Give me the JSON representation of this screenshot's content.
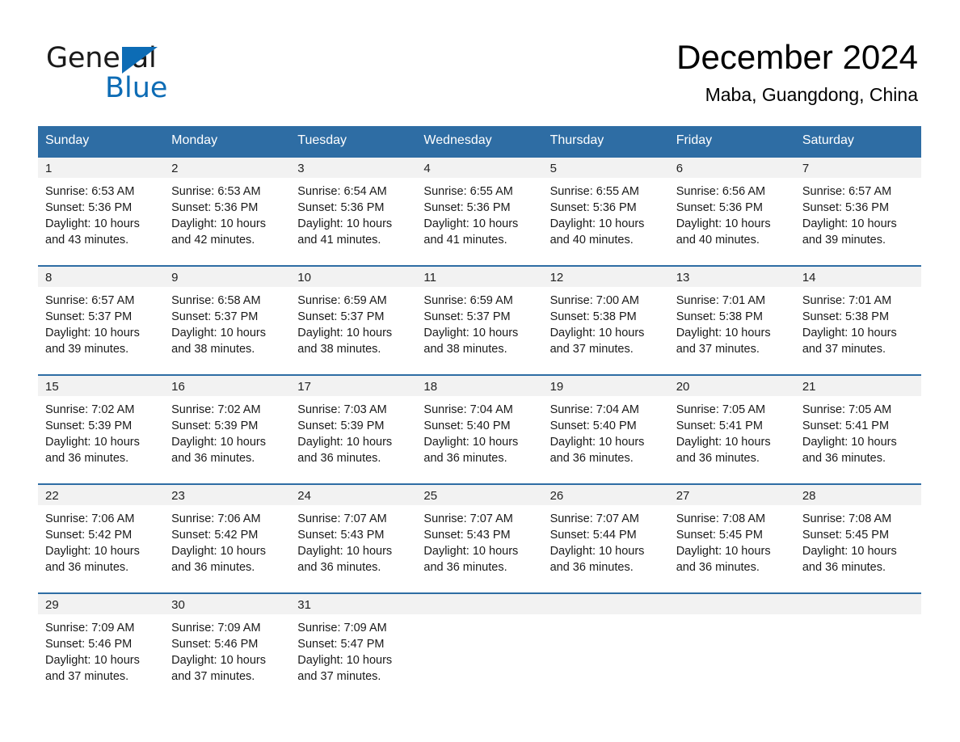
{
  "brand": {
    "word_general": "General",
    "word_blue": "Blue",
    "triangle_color": "#0d6cb5"
  },
  "header": {
    "title": "December 2024",
    "subtitle": "Maba, Guangdong, China"
  },
  "theme": {
    "header_blue": "#2e6da4",
    "day_strip_gray": "#f2f2f2",
    "text_black": "#1a1a1a"
  },
  "weekdays": [
    "Sunday",
    "Monday",
    "Tuesday",
    "Wednesday",
    "Thursday",
    "Friday",
    "Saturday"
  ],
  "weeks": [
    [
      {
        "day": "1",
        "sunrise": "Sunrise: 6:53 AM",
        "sunset": "Sunset: 5:36 PM",
        "daylight": "Daylight: 10 hours and 43 minutes."
      },
      {
        "day": "2",
        "sunrise": "Sunrise: 6:53 AM",
        "sunset": "Sunset: 5:36 PM",
        "daylight": "Daylight: 10 hours and 42 minutes."
      },
      {
        "day": "3",
        "sunrise": "Sunrise: 6:54 AM",
        "sunset": "Sunset: 5:36 PM",
        "daylight": "Daylight: 10 hours and 41 minutes."
      },
      {
        "day": "4",
        "sunrise": "Sunrise: 6:55 AM",
        "sunset": "Sunset: 5:36 PM",
        "daylight": "Daylight: 10 hours and 41 minutes."
      },
      {
        "day": "5",
        "sunrise": "Sunrise: 6:55 AM",
        "sunset": "Sunset: 5:36 PM",
        "daylight": "Daylight: 10 hours and 40 minutes."
      },
      {
        "day": "6",
        "sunrise": "Sunrise: 6:56 AM",
        "sunset": "Sunset: 5:36 PM",
        "daylight": "Daylight: 10 hours and 40 minutes."
      },
      {
        "day": "7",
        "sunrise": "Sunrise: 6:57 AM",
        "sunset": "Sunset: 5:36 PM",
        "daylight": "Daylight: 10 hours and 39 minutes."
      }
    ],
    [
      {
        "day": "8",
        "sunrise": "Sunrise: 6:57 AM",
        "sunset": "Sunset: 5:37 PM",
        "daylight": "Daylight: 10 hours and 39 minutes."
      },
      {
        "day": "9",
        "sunrise": "Sunrise: 6:58 AM",
        "sunset": "Sunset: 5:37 PM",
        "daylight": "Daylight: 10 hours and 38 minutes."
      },
      {
        "day": "10",
        "sunrise": "Sunrise: 6:59 AM",
        "sunset": "Sunset: 5:37 PM",
        "daylight": "Daylight: 10 hours and 38 minutes."
      },
      {
        "day": "11",
        "sunrise": "Sunrise: 6:59 AM",
        "sunset": "Sunset: 5:37 PM",
        "daylight": "Daylight: 10 hours and 38 minutes."
      },
      {
        "day": "12",
        "sunrise": "Sunrise: 7:00 AM",
        "sunset": "Sunset: 5:38 PM",
        "daylight": "Daylight: 10 hours and 37 minutes."
      },
      {
        "day": "13",
        "sunrise": "Sunrise: 7:01 AM",
        "sunset": "Sunset: 5:38 PM",
        "daylight": "Daylight: 10 hours and 37 minutes."
      },
      {
        "day": "14",
        "sunrise": "Sunrise: 7:01 AM",
        "sunset": "Sunset: 5:38 PM",
        "daylight": "Daylight: 10 hours and 37 minutes."
      }
    ],
    [
      {
        "day": "15",
        "sunrise": "Sunrise: 7:02 AM",
        "sunset": "Sunset: 5:39 PM",
        "daylight": "Daylight: 10 hours and 36 minutes."
      },
      {
        "day": "16",
        "sunrise": "Sunrise: 7:02 AM",
        "sunset": "Sunset: 5:39 PM",
        "daylight": "Daylight: 10 hours and 36 minutes."
      },
      {
        "day": "17",
        "sunrise": "Sunrise: 7:03 AM",
        "sunset": "Sunset: 5:39 PM",
        "daylight": "Daylight: 10 hours and 36 minutes."
      },
      {
        "day": "18",
        "sunrise": "Sunrise: 7:04 AM",
        "sunset": "Sunset: 5:40 PM",
        "daylight": "Daylight: 10 hours and 36 minutes."
      },
      {
        "day": "19",
        "sunrise": "Sunrise: 7:04 AM",
        "sunset": "Sunset: 5:40 PM",
        "daylight": "Daylight: 10 hours and 36 minutes."
      },
      {
        "day": "20",
        "sunrise": "Sunrise: 7:05 AM",
        "sunset": "Sunset: 5:41 PM",
        "daylight": "Daylight: 10 hours and 36 minutes."
      },
      {
        "day": "21",
        "sunrise": "Sunrise: 7:05 AM",
        "sunset": "Sunset: 5:41 PM",
        "daylight": "Daylight: 10 hours and 36 minutes."
      }
    ],
    [
      {
        "day": "22",
        "sunrise": "Sunrise: 7:06 AM",
        "sunset": "Sunset: 5:42 PM",
        "daylight": "Daylight: 10 hours and 36 minutes."
      },
      {
        "day": "23",
        "sunrise": "Sunrise: 7:06 AM",
        "sunset": "Sunset: 5:42 PM",
        "daylight": "Daylight: 10 hours and 36 minutes."
      },
      {
        "day": "24",
        "sunrise": "Sunrise: 7:07 AM",
        "sunset": "Sunset: 5:43 PM",
        "daylight": "Daylight: 10 hours and 36 minutes."
      },
      {
        "day": "25",
        "sunrise": "Sunrise: 7:07 AM",
        "sunset": "Sunset: 5:43 PM",
        "daylight": "Daylight: 10 hours and 36 minutes."
      },
      {
        "day": "26",
        "sunrise": "Sunrise: 7:07 AM",
        "sunset": "Sunset: 5:44 PM",
        "daylight": "Daylight: 10 hours and 36 minutes."
      },
      {
        "day": "27",
        "sunrise": "Sunrise: 7:08 AM",
        "sunset": "Sunset: 5:45 PM",
        "daylight": "Daylight: 10 hours and 36 minutes."
      },
      {
        "day": "28",
        "sunrise": "Sunrise: 7:08 AM",
        "sunset": "Sunset: 5:45 PM",
        "daylight": "Daylight: 10 hours and 36 minutes."
      }
    ],
    [
      {
        "day": "29",
        "sunrise": "Sunrise: 7:09 AM",
        "sunset": "Sunset: 5:46 PM",
        "daylight": "Daylight: 10 hours and 37 minutes."
      },
      {
        "day": "30",
        "sunrise": "Sunrise: 7:09 AM",
        "sunset": "Sunset: 5:46 PM",
        "daylight": "Daylight: 10 hours and 37 minutes."
      },
      {
        "day": "31",
        "sunrise": "Sunrise: 7:09 AM",
        "sunset": "Sunset: 5:47 PM",
        "daylight": "Daylight: 10 hours and 37 minutes."
      },
      {
        "day": "",
        "sunrise": "",
        "sunset": "",
        "daylight": ""
      },
      {
        "day": "",
        "sunrise": "",
        "sunset": "",
        "daylight": ""
      },
      {
        "day": "",
        "sunrise": "",
        "sunset": "",
        "daylight": ""
      },
      {
        "day": "",
        "sunrise": "",
        "sunset": "",
        "daylight": ""
      }
    ]
  ]
}
